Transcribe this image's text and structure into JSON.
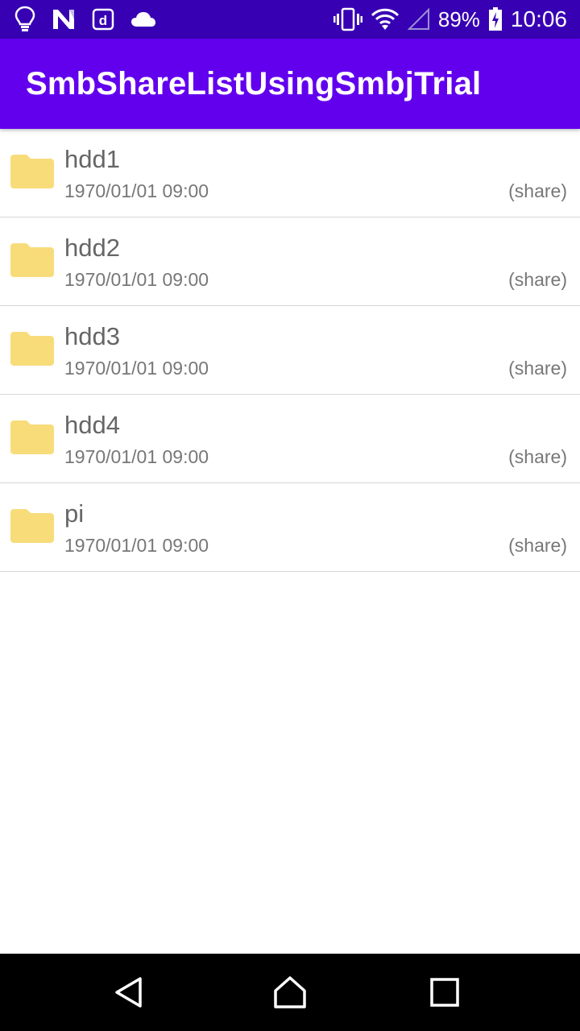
{
  "status_bar": {
    "icons_left": [
      "lightbulb-icon",
      "n-icon",
      "d-icon",
      "cloud-icon"
    ],
    "icons_right": [
      "vibrate-icon",
      "wifi-icon",
      "signal-icon",
      "battery-charging-icon"
    ],
    "battery_percent": "89%",
    "time": "10:06"
  },
  "app_bar": {
    "title": "SmbShareListUsingSmbjTrial",
    "color": "#6200ee"
  },
  "shares": [
    {
      "name": "hdd1",
      "date": "1970/01/01 09:00",
      "type": "(share)",
      "icon": "folder-icon"
    },
    {
      "name": "hdd2",
      "date": "1970/01/01 09:00",
      "type": "(share)",
      "icon": "folder-icon"
    },
    {
      "name": "hdd3",
      "date": "1970/01/01 09:00",
      "type": "(share)",
      "icon": "folder-icon"
    },
    {
      "name": "hdd4",
      "date": "1970/01/01 09:00",
      "type": "(share)",
      "icon": "folder-icon"
    },
    {
      "name": "pi",
      "date": "1970/01/01 09:00",
      "type": "(share)",
      "icon": "folder-icon"
    }
  ],
  "nav_bar": {
    "buttons": [
      "back-icon",
      "home-icon",
      "recents-icon"
    ]
  },
  "colors": {
    "status_bar": "#3700b3",
    "folder": "#f8dc7a"
  }
}
